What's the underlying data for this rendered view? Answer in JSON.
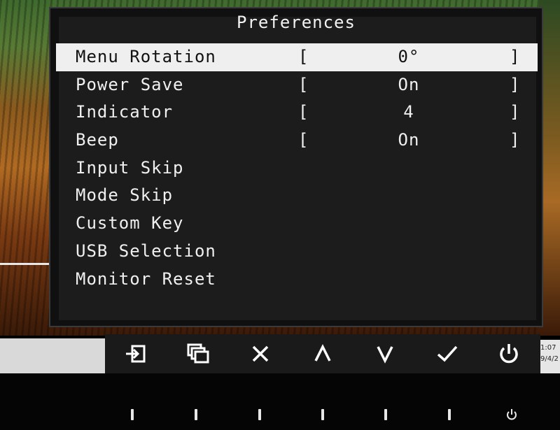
{
  "osd": {
    "title": "Preferences",
    "items": [
      {
        "label": "Menu Rotation",
        "value": "0°",
        "selected": true
      },
      {
        "label": "Power Save",
        "value": "On",
        "selected": false
      },
      {
        "label": "Indicator",
        "value": "4",
        "selected": false
      },
      {
        "label": "Beep",
        "value": "On",
        "selected": false
      },
      {
        "label": "Input Skip",
        "value": null,
        "selected": false
      },
      {
        "label": "Mode Skip",
        "value": null,
        "selected": false
      },
      {
        "label": "Custom Key",
        "value": null,
        "selected": false
      },
      {
        "label": "USB Selection",
        "value": null,
        "selected": false
      },
      {
        "label": "Monitor Reset",
        "value": null,
        "selected": false
      }
    ],
    "bracket_open": "[",
    "bracket_close": "]"
  },
  "guide_buttons": [
    {
      "icon": "input-switch-icon"
    },
    {
      "icon": "color-mode-icon"
    },
    {
      "icon": "close-icon"
    },
    {
      "icon": "chevron-up-icon"
    },
    {
      "icon": "chevron-down-icon"
    },
    {
      "icon": "checkmark-icon"
    },
    {
      "icon": "power-icon"
    }
  ],
  "taskbar": {
    "clock_time": "1:07",
    "clock_date": "9/4/2"
  },
  "colors": {
    "selected_row_bg": "#efefef",
    "osd_bg": "#1c1c1c",
    "text": "#f0f0f0"
  }
}
